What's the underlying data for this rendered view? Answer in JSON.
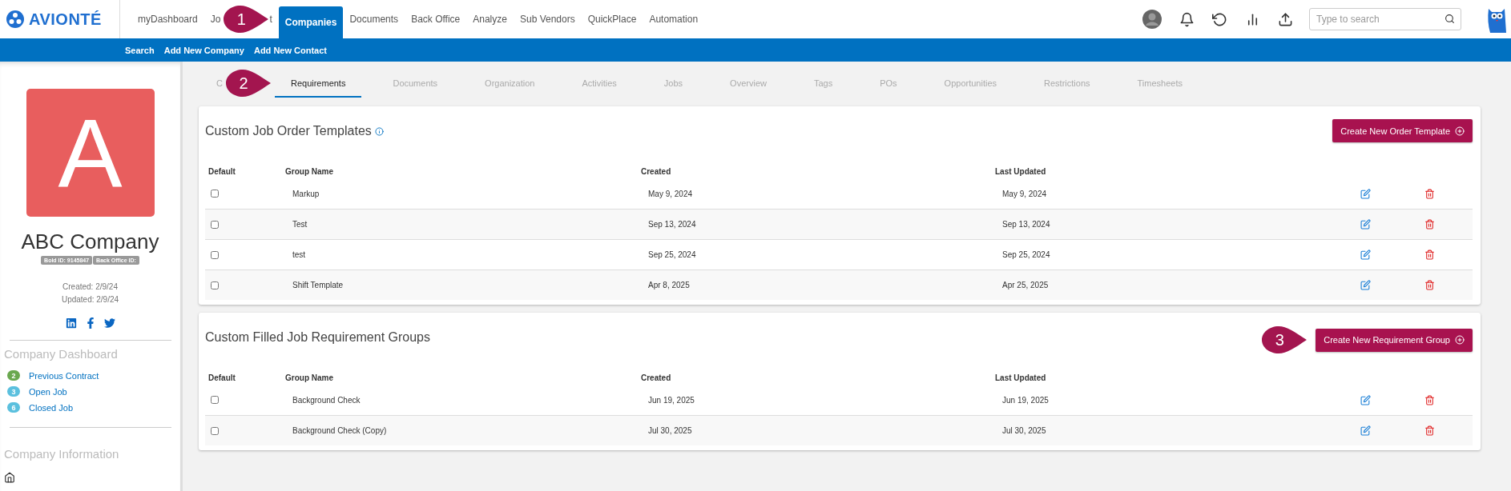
{
  "brand": {
    "name": "AVIONTÉ"
  },
  "nav": [
    {
      "label": "myDashboard",
      "selected": false
    },
    {
      "label": "Jo",
      "label_end": "t",
      "callout": "1",
      "selected": false
    },
    {
      "label": "Companies",
      "selected": true
    },
    {
      "label": "Documents",
      "selected": false
    },
    {
      "label": "Back Office",
      "selected": false
    },
    {
      "label": "Analyze",
      "selected": false
    },
    {
      "label": "Sub Vendors",
      "selected": false
    },
    {
      "label": "QuickPlace",
      "selected": false
    },
    {
      "label": "Automation",
      "selected": false
    }
  ],
  "search": {
    "placeholder": "Type to search"
  },
  "subnav": [
    "Search",
    "Add New Company",
    "Add New Contact"
  ],
  "company": {
    "initial": "A",
    "name": "ABC Company",
    "ids": [
      "Bold ID: 9145847",
      "Back Office ID:"
    ],
    "created": "Created: 2/9/24",
    "updated": "Updated: 2/9/24"
  },
  "dashboard": {
    "title": "Company Dashboard",
    "items": [
      {
        "count": "2",
        "label": "Previous Contract",
        "color": "#6aa84f"
      },
      {
        "count": "3",
        "label": "Open Job",
        "color": "#5bc0de"
      },
      {
        "count": "6",
        "label": "Closed Job",
        "color": "#5bc0de"
      }
    ]
  },
  "info": {
    "title": "Company Information"
  },
  "tabs": [
    {
      "label": "C",
      "callout": "2",
      "selected": false
    },
    {
      "label": "Requirements",
      "selected": true
    },
    {
      "label": "Documents",
      "selected": false
    },
    {
      "label": "Organization",
      "selected": false
    },
    {
      "label": "Activities",
      "selected": false
    },
    {
      "label": "Jobs",
      "selected": false
    },
    {
      "label": "Overview",
      "selected": false
    },
    {
      "label": "Tags",
      "selected": false
    },
    {
      "label": "POs",
      "selected": false
    },
    {
      "label": "Opportunities",
      "selected": false
    },
    {
      "label": "Restrictions",
      "selected": false
    },
    {
      "label": "Timesheets",
      "selected": false
    }
  ],
  "sections": [
    {
      "title": "Custom Job Order Templates",
      "info_icon": true,
      "button": "Create New Order Template",
      "columns": [
        "Default",
        "Group Name",
        "Created",
        "Last Updated"
      ],
      "rows": [
        {
          "checked": false,
          "name": "Markup",
          "created": "May 9, 2024",
          "updated": "May 9, 2024"
        },
        {
          "checked": false,
          "name": "Test",
          "created": "Sep 13, 2024",
          "updated": "Sep 13, 2024"
        },
        {
          "checked": false,
          "name": "test",
          "created": "Sep 25, 2024",
          "updated": "Sep 25, 2024"
        },
        {
          "checked": false,
          "name": "Shift Template",
          "created": "Apr 8, 2025",
          "updated": "Apr 25, 2025"
        }
      ]
    },
    {
      "title": "Custom Filled Job Requirement Groups",
      "info_icon": false,
      "callout": "3",
      "button": "Create New Requirement Group",
      "columns": [
        "Default",
        "Group Name",
        "Created",
        "Last Updated"
      ],
      "rows": [
        {
          "checked": false,
          "name": "Background Check",
          "created": "Jun 19, 2025",
          "updated": "Jun 19, 2025"
        },
        {
          "checked": false,
          "name": "Background Check (Copy)",
          "created": "Jul 30, 2025",
          "updated": "Jul 30, 2025"
        }
      ]
    }
  ]
}
